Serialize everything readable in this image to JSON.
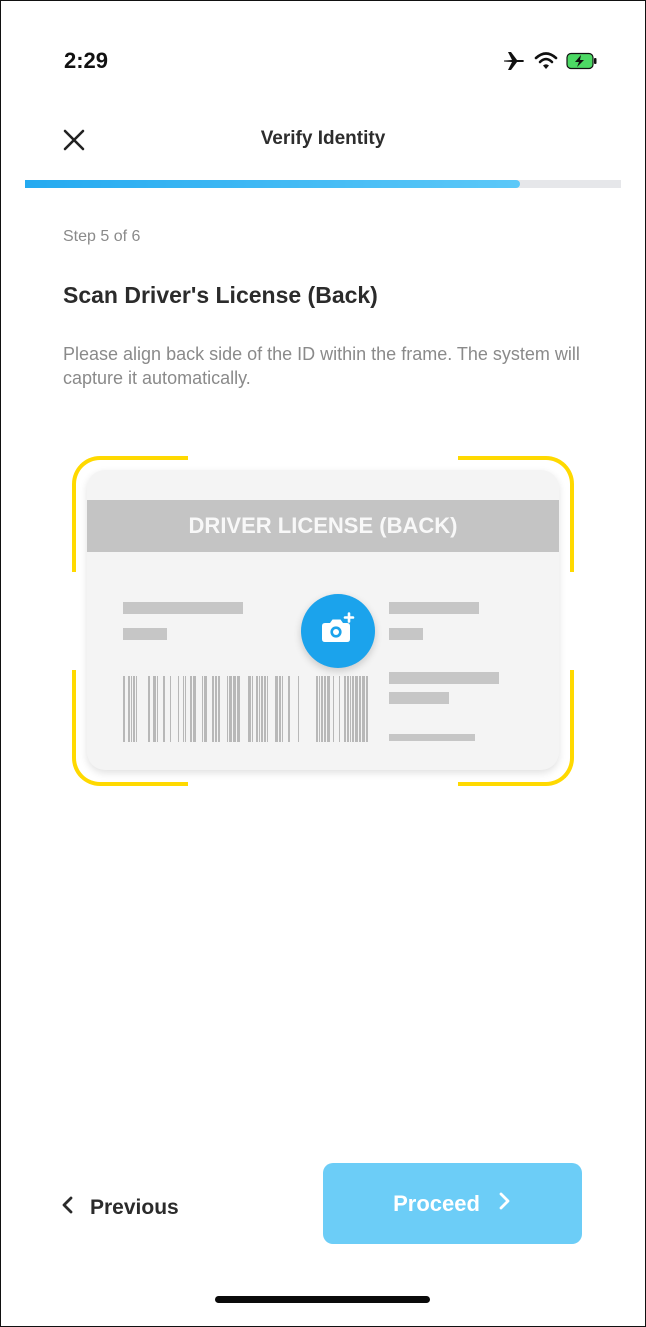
{
  "status_bar": {
    "time": "2:29",
    "icons": [
      "airplane-mode-icon",
      "wifi-icon",
      "battery-charging-icon"
    ]
  },
  "header": {
    "title": "Verify Identity",
    "close_icon": "close-icon"
  },
  "progress": {
    "fraction": 0.83,
    "fill_color": "#3ab8f4",
    "track_color": "#e6e7ea"
  },
  "content": {
    "step_label": "Step 5 of 6",
    "heading": "Scan Driver's License (Back)",
    "description": "Please align back side of the ID within the frame. The system will capture it automatically."
  },
  "card": {
    "title": "DRIVER LICENSE (BACK)",
    "camera_icon": "camera-add-icon",
    "frame_color": "#ffd900"
  },
  "footer": {
    "previous_label": "Previous",
    "proceed_label": "Proceed",
    "proceed_color": "#6ccdf7"
  }
}
